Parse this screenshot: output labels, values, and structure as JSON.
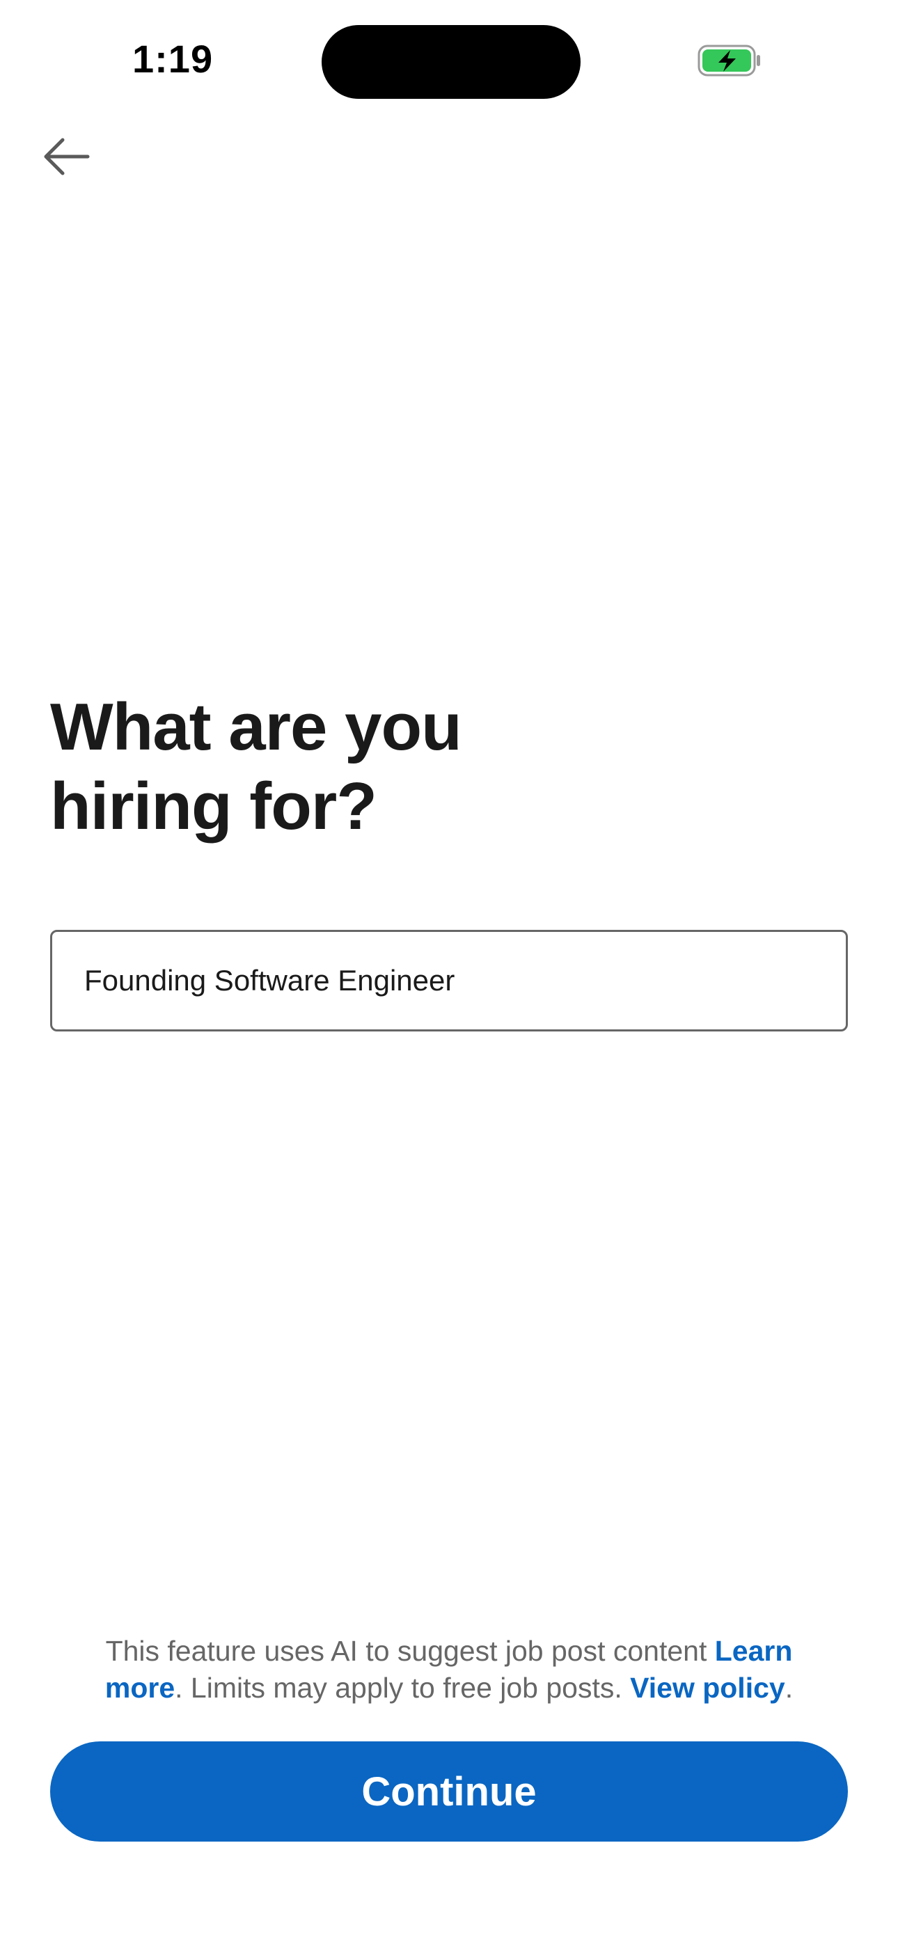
{
  "status_bar": {
    "time": "1:19",
    "battery_icon": "battery-charging-icon",
    "battery_color": "#34c759"
  },
  "header": {
    "back_icon": "arrow-left-icon"
  },
  "main": {
    "title_line1": "What are you",
    "title_line2": "hiring for?",
    "job_title_value": "Founding Software Engineer"
  },
  "footer": {
    "disclaimer_text_1": "This feature uses AI to suggest job post content ",
    "learn_more_link": "Learn more",
    "disclaimer_text_2": ". Limits may apply to free job posts. ",
    "view_policy_link": "View policy",
    "disclaimer_text_3": ".",
    "continue_label": "Continue"
  },
  "colors": {
    "accent": "#0a66c2",
    "text_primary": "#1a1a1a",
    "text_secondary": "#666666"
  }
}
